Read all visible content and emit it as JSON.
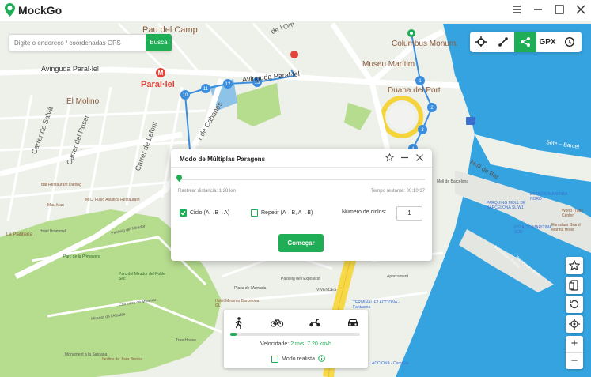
{
  "app": {
    "name": "MockGo"
  },
  "search": {
    "placeholder": "Digite o endereço / coordenadas GPS",
    "button": "Busca"
  },
  "toolbar": {
    "gpx_label": "GPX",
    "icons": [
      "crosshair-icon",
      "two-point-route-icon",
      "multi-stop-route-icon",
      "gpx-icon",
      "history-icon"
    ]
  },
  "map_labels": {
    "pau_del_camp": "Pau del Camp",
    "street_om": "de l'Om",
    "columbus": "Columbus Monum.",
    "museu": "Museu Marítim",
    "avinguda1": "Avinguda Paral·lel",
    "avinguda2": "Avinguda Paral·lel",
    "metro": "Paral·lel",
    "el_molino": "El Molino",
    "duana": "Duana del Port",
    "carrer_salva": "Carrer de Salvà",
    "carrer_roser": "Carrer del Roser",
    "carrer_lafont": "Carrer de Lafont",
    "cabanes": "r de Cabanes",
    "sete": "Sète – Barcel",
    "moll": "Moll de Bar",
    "bar_restaurant": "Bar Restaurant Darling",
    "mcfusio": "M.C. Fusió Asiática Restaurant",
    "mau": "Mau Mau",
    "hotel_brummell": "Hotel Brummell",
    "la_platilleria": "La Platillería",
    "passeig_mirador": "Passeig del Mirador",
    "parc_primavera": "Parc de la Primavera",
    "parc_poble_sec": "Parc del Mirador del Poble Sec",
    "parc_primavera_small": "Parc de la Primavera",
    "pl_armada": "Plaça de l'Armada",
    "hotel_miramar": "Hotel Miramar Barcelona GL",
    "carrer_miramar": "Carretera de Miramar",
    "mirador_alcalde": "Mirador de l'Alcalde",
    "monument": "Monument a la Sardana",
    "jardins_joan": "Jardins de Joan Brossa",
    "tree_house": "Tree House",
    "aparcament": "Aparcament",
    "terminal": "TERMINAL F2 ACCIONA - Fantasma",
    "acciona": "ACCIONA - Camions",
    "parking": "PARQUING MOLL DE BARCELONA SL W1",
    "estacio_nord": "ESTACIO MARITIMA NORD",
    "estacio_sud": "ESTACIO MARITIMA SUD",
    "world_trade": "World Trade Center",
    "eurostars": "Eurostars Grand Marina Hotel",
    "vivendes": "VIVENDES",
    "barcelona_ferry": "Barcelona - Palma",
    "barcelona_ferry2": "Barcelona - Ibiza",
    "muralla": "Moll de Barcelona",
    "armada_small": "Passeig de l'Exposició"
  },
  "route_markers": [
    "1",
    "2",
    "3",
    "4",
    "10",
    "11",
    "12",
    "13"
  ],
  "dialog": {
    "title": "Modo de Múltiplas Paragens",
    "distance": "Rastrear distância: 1.28 km",
    "time": "Tempo restante: 00:10:37",
    "cycle_label": "Ciclo (A→B→A)",
    "repeat_label": "Repetir (A→B, A→B)",
    "cycles_label": "Número de ciclos:",
    "cycles_value": "1",
    "start_label": "Começar",
    "cycle_checked": true,
    "repeat_checked": false,
    "progress": 0
  },
  "speed": {
    "label": "Velocidade:",
    "value": "2 m/s, 7.20 km/h",
    "realistic": "Modo realista",
    "modes": [
      "walk-icon",
      "bike-icon",
      "scooter-icon",
      "car-icon"
    ],
    "level": 0.05
  },
  "colors": {
    "accent": "#1fae55",
    "route": "#3b8ede",
    "sea": "#35a3df",
    "park": "#b6dc8e",
    "metro": "#e0463c"
  }
}
